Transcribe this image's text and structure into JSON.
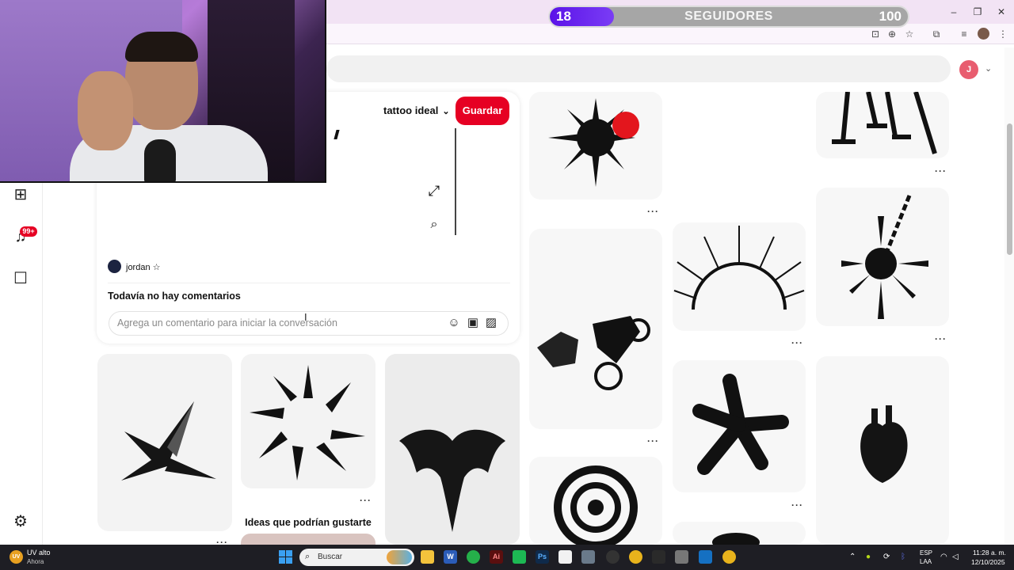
{
  "stream_overlay": {
    "followers_current": "18",
    "followers_label": "SEGUIDORES",
    "followers_goal": "100",
    "progress_fraction": 0.18
  },
  "browser": {
    "window_controls": [
      "–",
      "❐",
      "✕"
    ],
    "toolbar_icons": [
      "install-icon",
      "zoom-icon",
      "bookmark-star-icon",
      "extensions-icon",
      "media-icon",
      "profile-avatar",
      "menu-icon"
    ]
  },
  "header": {
    "user_initial": "J"
  },
  "sidebar": {
    "items": [
      {
        "icon": "create-icon",
        "glyph": "⊞"
      },
      {
        "icon": "notifications-icon",
        "glyph": "🔔",
        "badge": "99+"
      },
      {
        "icon": "messages-icon",
        "glyph": "💬"
      },
      {
        "icon": "settings-icon",
        "glyph": "⚙"
      }
    ]
  },
  "pin_detail": {
    "board_name": "tattoo ideal",
    "save_label": "Guardar",
    "author": "jordan ☆",
    "comments_title": "Todavía no hay comentarios",
    "comment_placeholder": "Agrega un comentario para iniciar la conversación"
  },
  "related": {
    "ideas_title": "Ideas que podrían gustarte",
    "more_label": "···"
  },
  "pins": [
    {
      "name": "spiky-star-tattoo"
    },
    {
      "name": "sun-shards-tattoo"
    },
    {
      "name": "bat-tattoo"
    },
    {
      "name": "spiky-heart-tattoo"
    },
    {
      "name": "motorbike-horse-tattoo"
    },
    {
      "name": "spiral-tattoo"
    },
    {
      "name": "thorn-arc-tattoo"
    },
    {
      "name": "graffiti-star-tattoo"
    },
    {
      "name": "nails-tattoo"
    },
    {
      "name": "chain-mace-tattoo"
    },
    {
      "name": "anatomical-heart-tattoo"
    }
  ],
  "taskbar": {
    "weather_title": "UV alto",
    "weather_sub": "Ahora",
    "weather_badge": "UV",
    "search_label": "Buscar",
    "lang_1": "ESP",
    "lang_2": "LAA",
    "time": "11:28 a. m.",
    "date": "12/10/2025"
  }
}
